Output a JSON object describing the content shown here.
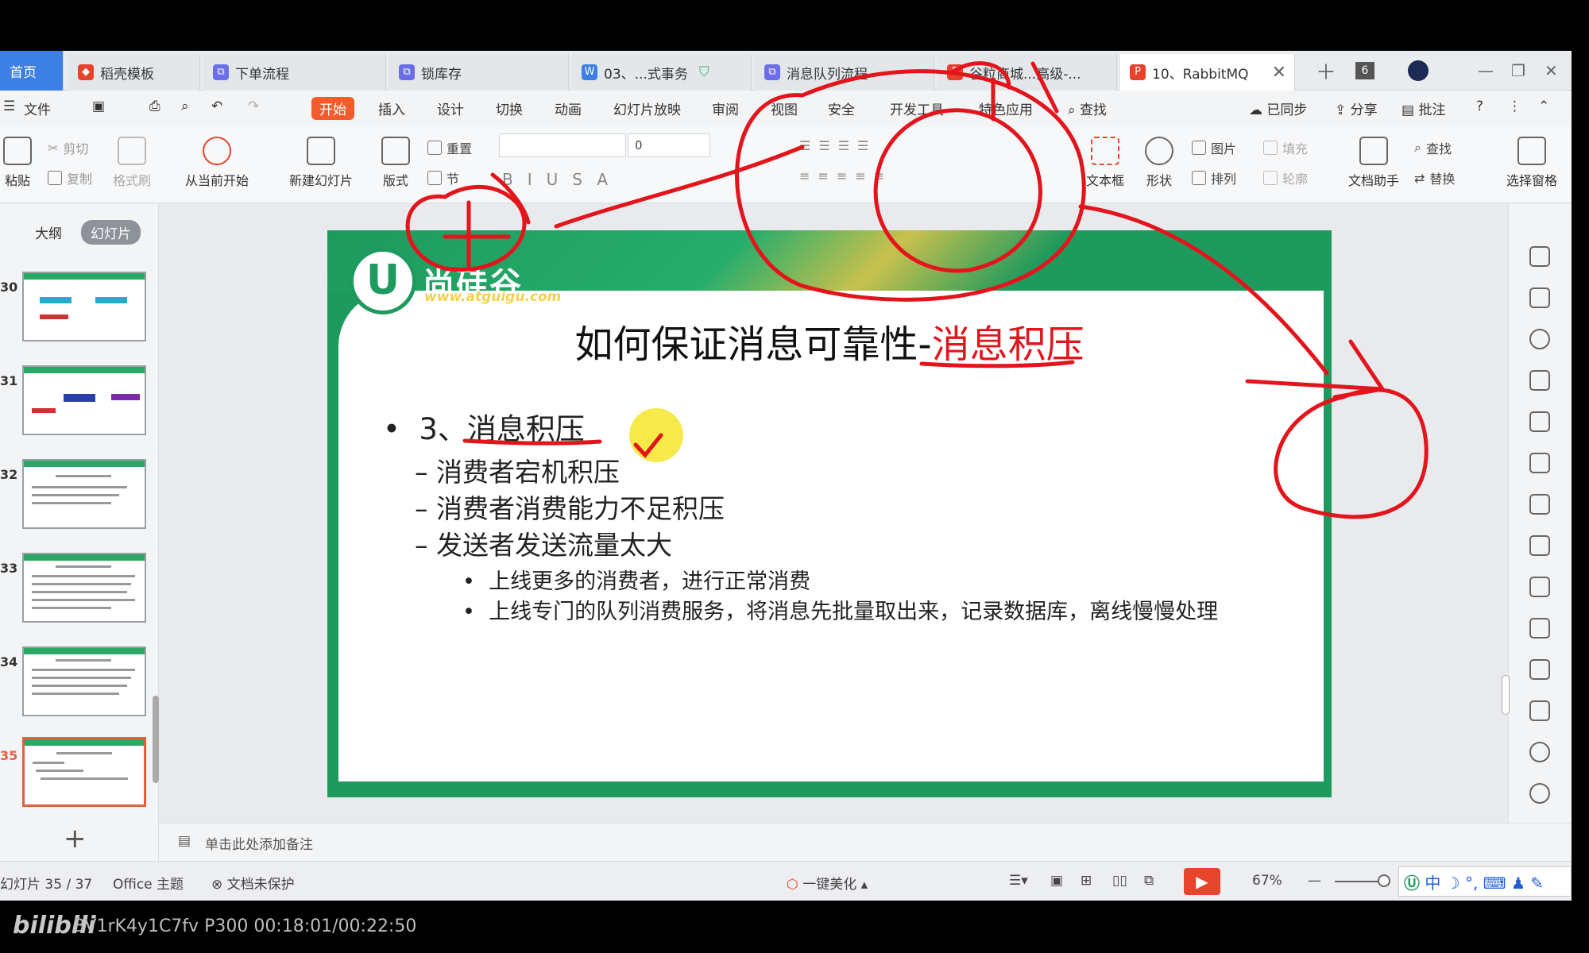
{
  "tabs": [
    {
      "label": "首页"
    },
    {
      "label": "稻壳模板"
    },
    {
      "label": "下单流程"
    },
    {
      "label": "锁库存"
    },
    {
      "label": "03、...式事务"
    },
    {
      "label": "消息队列流程"
    },
    {
      "label": "谷粒商城...高级-..."
    },
    {
      "label": "10、RabbitMQ"
    }
  ],
  "tab_counter": "6",
  "menu": {
    "file": "文件",
    "items": [
      "开始",
      "插入",
      "设计",
      "切换",
      "动画",
      "幻灯片放映",
      "审阅",
      "视图",
      "安全",
      "开发工具",
      "特色应用",
      "查找"
    ],
    "right": [
      "已同步",
      "分享",
      "批注"
    ]
  },
  "ribbon": {
    "paste": "粘贴",
    "cut": "剪切",
    "copy": "复制",
    "format_brush": "格式刷",
    "from_current": "从当前开始",
    "new_slide": "新建幻灯片",
    "layout": "版式",
    "reset": "重置",
    "section": "节",
    "font_size": "0",
    "text_box": "文本框",
    "shape": "形状",
    "picture": "图片",
    "arrange": "排列",
    "fill": "填充",
    "outline": "轮廓",
    "doc_helper": "文档助手",
    "find": "查找",
    "replace": "替换",
    "select_pane": "选择窗格"
  },
  "panel": {
    "outline_tab": "大纲",
    "slides_tab": "幻灯片",
    "thumb_numbers": [
      "30",
      "31",
      "32",
      "33",
      "34",
      "35"
    ]
  },
  "slide": {
    "brand": "尚硅谷",
    "url": "www.atguigu.com",
    "title_main": "如何保证消息可靠性-",
    "title_red": "消息积压",
    "bullet1": "3、消息积压",
    "sub": [
      "消费者宕机积压",
      "消费者消费能力不足积压",
      "发送者发送流量太大"
    ],
    "subsub": [
      "上线更多的消费者，进行正常消费",
      "上线专门的队列消费服务，将消息先批量取出来，记录数据库，离线慢慢处理"
    ]
  },
  "notes_placeholder": "单击此处添加备注",
  "status": {
    "slide_count": "幻灯片 35 / 37",
    "theme": "Office 主题",
    "protect": "文档未保护",
    "beautify": "一键美化",
    "zoom": "67%"
  },
  "player": {
    "logo": "bilibili",
    "info": "BV1rK4y1C7fv P300 00:18:01/00:22:50"
  },
  "colors": {
    "accent": "#f25b2b",
    "slide_green": "#1e9a5e",
    "title_red": "#e3141b",
    "ink_red": "#e3141b"
  }
}
